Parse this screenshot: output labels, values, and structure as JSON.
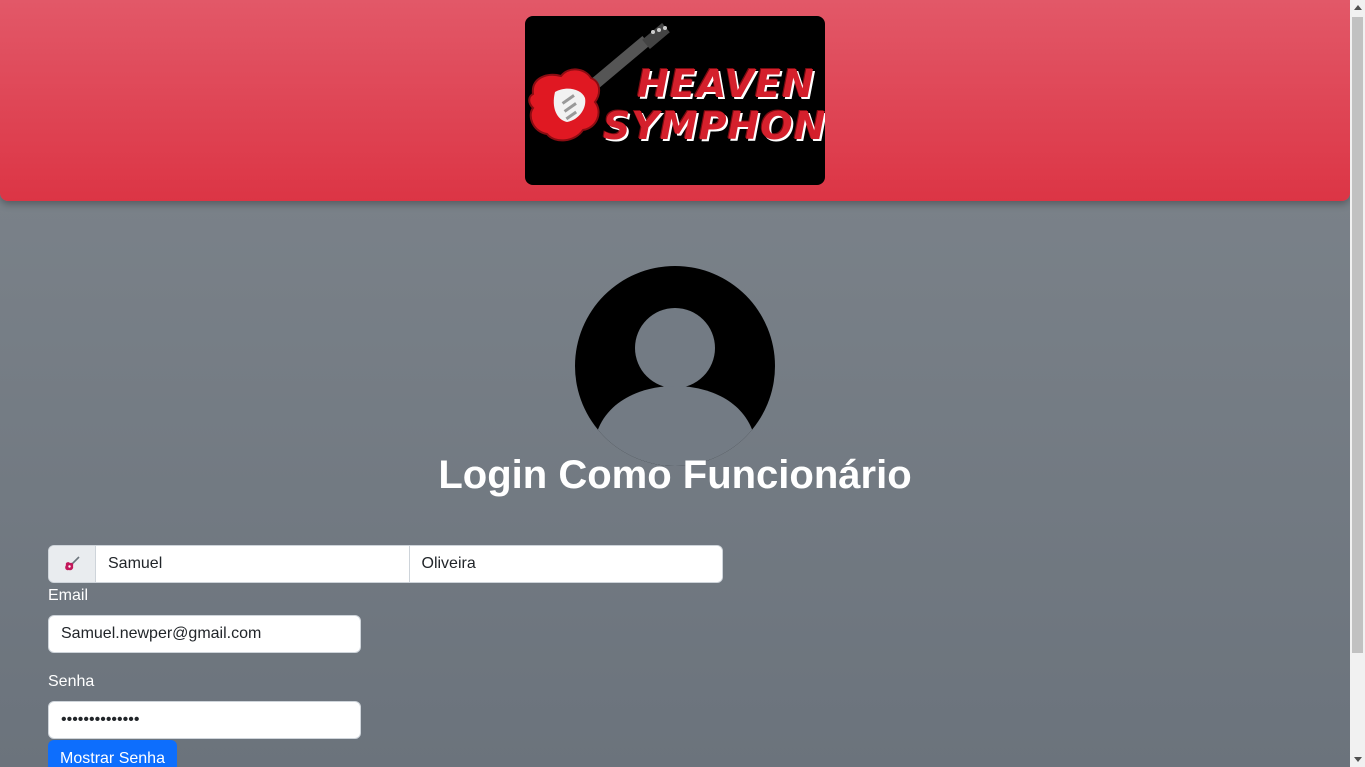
{
  "brand": {
    "logo_line1": "HEAVEN",
    "logo_line2": "SYMPHONY",
    "header_color": "#dc3545"
  },
  "main": {
    "title": "Login Como Funcionário",
    "name_group": {
      "icon": "guitar-icon",
      "first_name_value": "Samuel",
      "last_name_value": "Oliveira"
    },
    "email": {
      "label": "Email",
      "value": "Samuel.newper@gmail.com"
    },
    "password": {
      "label": "Senha",
      "value": "••••••••••••••"
    },
    "show_password_button": "Mostrar Senha"
  },
  "colors": {
    "primary_button": "#0d6efd",
    "background": "#737b84"
  }
}
